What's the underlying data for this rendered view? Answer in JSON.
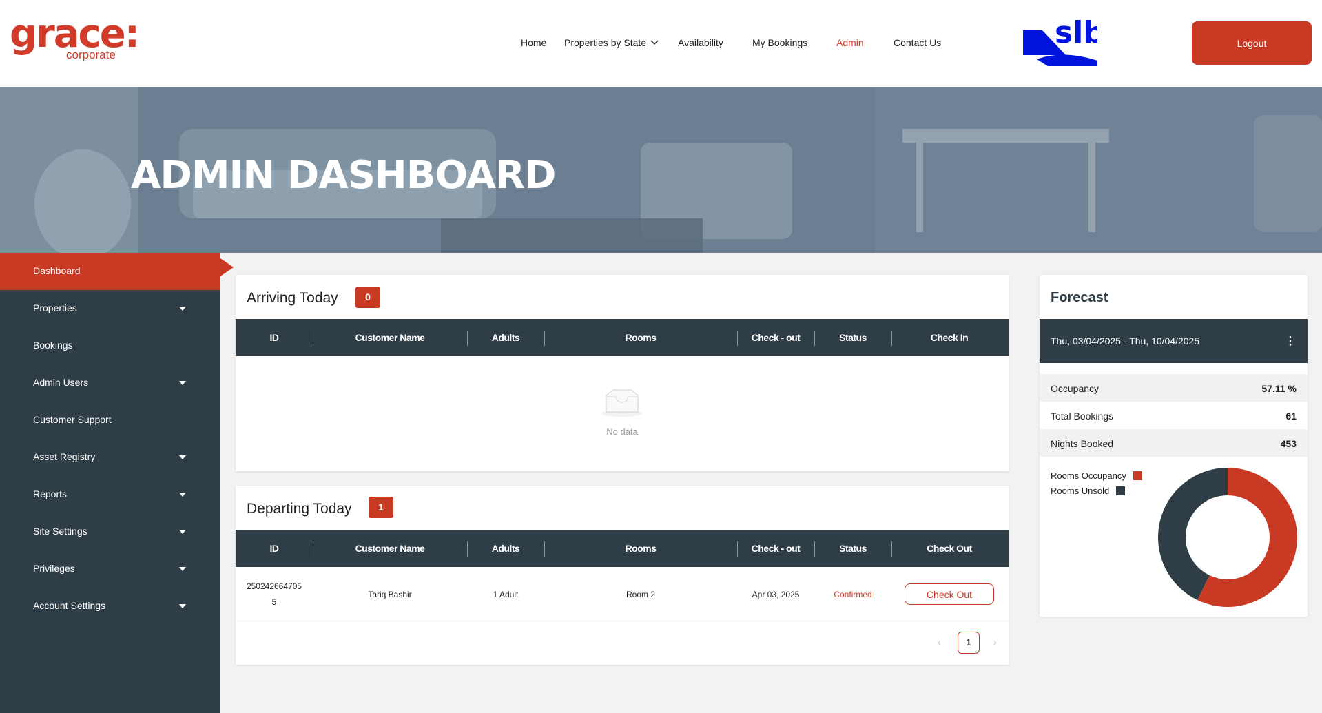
{
  "brand": {
    "logo_main": "grace:",
    "logo_sub": "corporate",
    "partner_logo": "slb"
  },
  "nav": {
    "items": [
      "Home",
      "Properties by State",
      "Availability",
      "My Bookings",
      "Admin",
      "Contact Us"
    ],
    "active": "Admin",
    "logout_label": "Logout"
  },
  "hero": {
    "title": "ADMIN DASHBOARD"
  },
  "sidebar": {
    "items": [
      {
        "label": "Dashboard",
        "active": true,
        "has_submenu": false
      },
      {
        "label": "Properties",
        "has_submenu": true
      },
      {
        "label": "Bookings",
        "has_submenu": false
      },
      {
        "label": "Admin Users",
        "has_submenu": true
      },
      {
        "label": "Customer Support",
        "has_submenu": false
      },
      {
        "label": "Asset Registry",
        "has_submenu": true
      },
      {
        "label": "Reports",
        "has_submenu": true
      },
      {
        "label": "Site Settings",
        "has_submenu": true
      },
      {
        "label": "Privileges",
        "has_submenu": true
      },
      {
        "label": "Account Settings",
        "has_submenu": true
      }
    ]
  },
  "arriving": {
    "title": "Arriving Today",
    "count": "0",
    "columns": [
      "ID",
      "Customer Name",
      "Adults",
      "Rooms",
      "Check - out",
      "Status",
      "Check In"
    ],
    "empty_text": "No data"
  },
  "departing": {
    "title": "Departing Today",
    "count": "1",
    "columns": [
      "ID",
      "Customer Name",
      "Adults",
      "Rooms",
      "Check - out",
      "Status",
      "Check Out"
    ],
    "rows": [
      {
        "id_line1": "250242664705",
        "id_line2": "5",
        "customer": "Tariq Bashir",
        "adults": "1 Adult",
        "rooms": "Room 2",
        "checkout": "Apr 03, 2025",
        "status": "Confirmed",
        "action": "Check Out"
      }
    ],
    "pagination": {
      "prev": "‹",
      "current": "1",
      "next": "›"
    }
  },
  "forecast": {
    "title": "Forecast",
    "date_range": "Thu, 03/04/2025 - Thu, 10/04/2025",
    "menu_icon": "⋮",
    "stats": [
      {
        "label": "Occupancy",
        "value": "57.11 %"
      },
      {
        "label": "Total Bookings",
        "value": "61"
      },
      {
        "label": "Nights Booked",
        "value": "453"
      }
    ],
    "legend": [
      {
        "label": "Rooms Occupancy",
        "color": "#c93a25"
      },
      {
        "label": "Rooms Unsold",
        "color": "#2f3e46"
      }
    ],
    "occupancy_fraction": 0.5711
  },
  "colors": {
    "accent": "#c93a25",
    "dark": "#2f3e46",
    "slb_blue": "#0014dc"
  }
}
